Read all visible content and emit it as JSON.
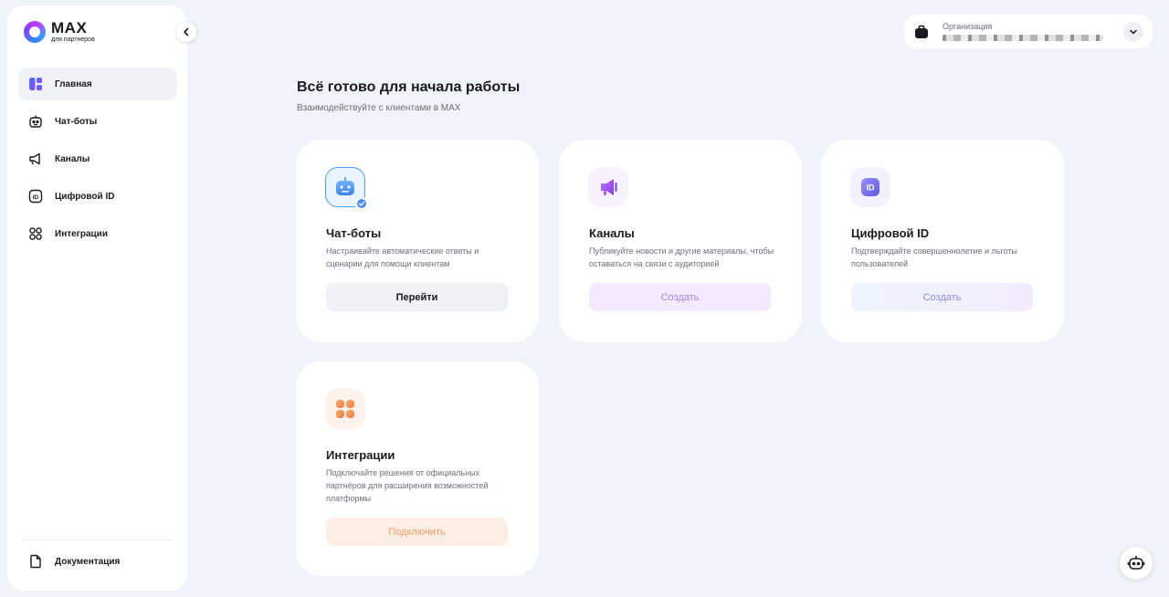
{
  "brand": {
    "title": "MAX",
    "subtitle": "для партнеров"
  },
  "sidebar": {
    "items": [
      {
        "label": "Главная",
        "icon": "home-grid-icon",
        "active": true
      },
      {
        "label": "Чат-боты",
        "icon": "bot-icon",
        "active": false
      },
      {
        "label": "Каналы",
        "icon": "megaphone-icon",
        "active": false
      },
      {
        "label": "Цифровой ID",
        "icon": "id-icon",
        "active": false
      },
      {
        "label": "Интеграции",
        "icon": "integrations-icon",
        "active": false
      }
    ],
    "documentation_label": "Документация"
  },
  "org": {
    "label": "Организация",
    "value_redacted": true
  },
  "header": {
    "title": "Всё готово для начала работы",
    "subtitle": "Взаимодействуйте с клиентами в MAX"
  },
  "cards": [
    {
      "title": "Чат-боты",
      "description": "Настраивайте автоматические ответы и сценарии для помощи клиентам",
      "button": "Перейти",
      "icon": "bot-icon",
      "accent": "#4a8af4"
    },
    {
      "title": "Каналы",
      "description": "Публикуйте новости и другие материалы, чтобы оставаться на связи с аудиторией",
      "button": "Создать",
      "icon": "megaphone-icon",
      "accent": "#9b5cf0"
    },
    {
      "title": "Цифровой ID",
      "description": "Подтверждайте совершеннолетие и льготы пользователей",
      "button": "Создать",
      "icon": "id-icon",
      "accent": "#7a6cf0"
    },
    {
      "title": "Интеграции",
      "description": "Подключайте решения от официальных партнёров для расширения возможностей платформы",
      "button": "Подключить",
      "icon": "integrations-icon",
      "accent": "#f08a4b"
    }
  ]
}
